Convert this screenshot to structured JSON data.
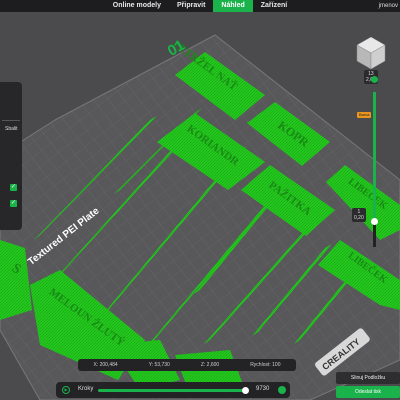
{
  "tabs": [
    {
      "label": "Online modely"
    },
    {
      "label": "Připravit"
    },
    {
      "label": "Náhled"
    },
    {
      "label": "Zařízení"
    }
  ],
  "user": "jmenov",
  "plate": {
    "number": "01",
    "name": "Textured PEI Plate",
    "brand": "CREALITY"
  },
  "labels": [
    {
      "text": "PETRŽEL NAŤ"
    },
    {
      "text": "KORIANDR"
    },
    {
      "text": "KOPR"
    },
    {
      "text": "PAŽITKA"
    },
    {
      "text": "LIBEČEK"
    },
    {
      "text": "LIBEČEK"
    },
    {
      "text": "MELOUN ŽLUTÝ"
    },
    {
      "text": "S"
    }
  ],
  "sidebar": {
    "items": [
      {
        "label": "Sbalit"
      }
    ]
  },
  "vertical_slider": {
    "top_layer": "13",
    "top_height": "2,60",
    "bottom_layer": "1",
    "bottom_height": "0,20",
    "badge": "Barva"
  },
  "coords": {
    "x": "X: 200,484",
    "y": "Y: 53,730",
    "z": "Z: 2,600",
    "speed": "Rychlost: 100"
  },
  "steps": {
    "label": "Kroky",
    "value": "9730",
    "progress": 0.98
  },
  "buttons": {
    "slice": "Slinuj Podložku",
    "send": "Odeslat tisk"
  },
  "colors": {
    "accent": "#19b24b",
    "model": "#22c91c",
    "bed": "#555558",
    "orange": "#e8961e"
  }
}
